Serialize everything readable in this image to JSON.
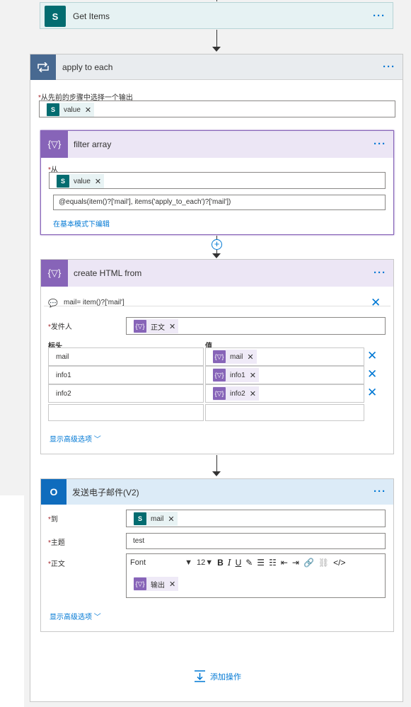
{
  "get_items": {
    "title": "Get Items"
  },
  "apply_each": {
    "title": "apply to each",
    "output_label": "从先前的步骤中选择一个输出",
    "token": "value"
  },
  "filter_array": {
    "title": "filter array",
    "from_label": "从",
    "token": "value",
    "expression": "@equals(item()?['mail'], items('apply_to_each')?['mail'])",
    "basic_mode_link": "在基本模式下编辑"
  },
  "create_html": {
    "title": "create HTML from",
    "comment": "mail= item()?['mail']",
    "sender_label": "发件人",
    "sender_token": "正文",
    "col_header": "标头",
    "col_value": "值",
    "rows": [
      {
        "header": "mail",
        "value": "mail"
      },
      {
        "header": "info1",
        "value": "info1"
      },
      {
        "header": "info2",
        "value": "info2"
      }
    ],
    "advanced_link": "显示高级选项"
  },
  "send_email": {
    "title": "发送电子邮件(V2)",
    "to_label": "到",
    "to_token": "mail",
    "subject_label": "主题",
    "subject_value": "test",
    "body_label": "正文",
    "font_label": "Font",
    "font_size": "12",
    "body_token": "输出",
    "advanced_link": "显示高级选项"
  },
  "add_action": {
    "label": "添加操作"
  },
  "colors": {
    "accent": "#0078d4",
    "sharepoint": "#036c70",
    "purple": "#8764b8",
    "outlook": "#0f6cbd"
  }
}
